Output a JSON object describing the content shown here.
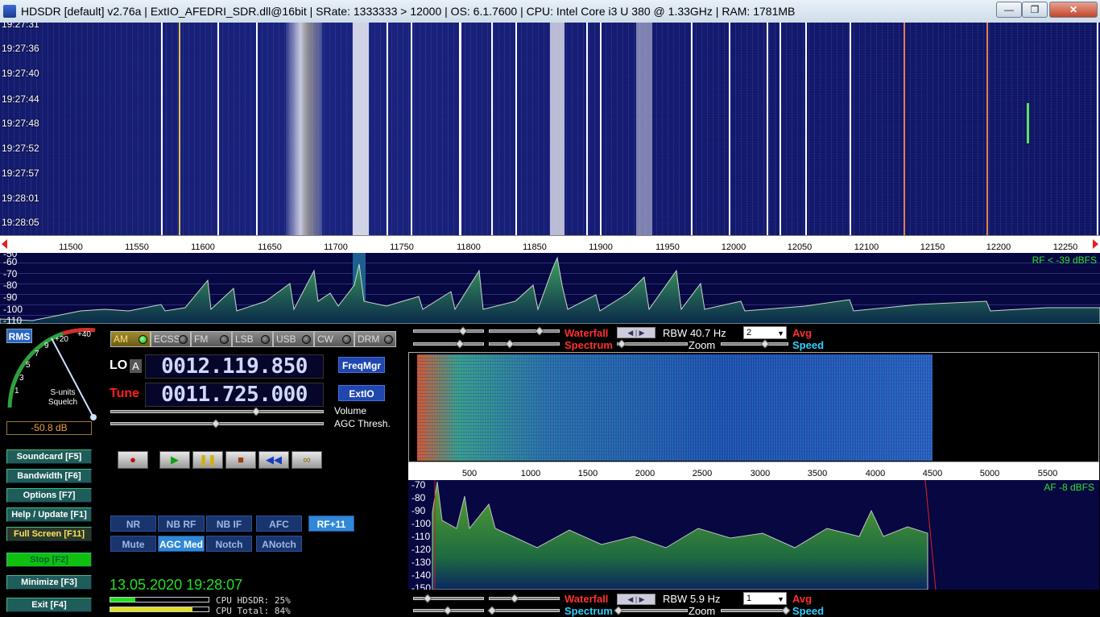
{
  "title_bar": {
    "text": "HDSDR  [default]  v2.76a  |  ExtIO_AFEDRI_SDR.dll@16bit  |  SRate: 1333333 > 12000  |  OS: 6.1.7600    |  CPU: Intel Core i3       U 380  @ 1.33GHz  |  RAM: 1781MB",
    "minimize": "—",
    "maximize": "❐",
    "close": "✕"
  },
  "waterfall_top": {
    "timestamps": [
      "19:27:31",
      "19:27:36",
      "19:27:40",
      "19:27:44",
      "19:27:48",
      "19:27:52",
      "19:27:57",
      "19:28:01",
      "19:28:05"
    ]
  },
  "freq_axis": {
    "ticks": [
      "11500",
      "11550",
      "11600",
      "11650",
      "11700",
      "11750",
      "11800",
      "11850",
      "11900",
      "11950",
      "12000",
      "12050",
      "12100",
      "12150",
      "12200",
      "12250"
    ]
  },
  "rf_spectrum": {
    "db_labels": [
      "-50",
      "-60",
      "-70",
      "-80",
      "-90",
      "-100",
      "-110"
    ],
    "rf_status": "RF < -39 dBFS"
  },
  "smeter": {
    "rms_label": "RMS",
    "scale": [
      "1",
      "3",
      "5",
      "7",
      "9",
      "+20",
      "+40"
    ],
    "s_units": "S-units",
    "squelch": "Squelch",
    "readout": "-50.8 dB"
  },
  "modes": [
    {
      "label": "AM",
      "active": true
    },
    {
      "label": "ECSS",
      "active": false
    },
    {
      "label": "FM",
      "active": false
    },
    {
      "label": "LSB",
      "active": false
    },
    {
      "label": "USB",
      "active": false
    },
    {
      "label": "CW",
      "active": false
    },
    {
      "label": "DRM",
      "active": false
    }
  ],
  "lo": {
    "label": "LO",
    "lock": "A",
    "freq": "0012.119.850"
  },
  "tune": {
    "label": "Tune",
    "freq": "0011.725.000"
  },
  "buttons_right_freq": {
    "freqmgr": "FreqMgr",
    "extio": "ExtIO"
  },
  "sliders": {
    "volume": "Volume",
    "agc": "AGC Thresh."
  },
  "transport": {
    "record": "●",
    "play": "▶",
    "pause": "❚❚",
    "stop": "■",
    "rewind": "◀◀",
    "loop": "∞"
  },
  "dsp_row1": [
    "NR",
    "NB RF",
    "NB IF",
    "AFC",
    "RF+11"
  ],
  "dsp_row2": [
    "Mute",
    "AGC Med",
    "Notch",
    "ANotch"
  ],
  "left_buttons": {
    "soundcard": "Soundcard   [F5]",
    "bandwidth": "Bandwidth   [F6]",
    "options": "Options   [F7]",
    "help": "Help / Update   [F1]",
    "fullscreen": "Full Screen   [F11]",
    "stop": "Stop        [F2]",
    "minimize": "Minimize   [F3]",
    "exit": "Exit         [F4]"
  },
  "status": {
    "datetime": "13.05.2020 19:28:07",
    "cpu_hdsdr": "CPU HDSDR: 25%",
    "cpu_total": "CPU Total: 84%",
    "cpu_hdsdr_fraction": 0.25,
    "cpu_total_fraction": 0.84
  },
  "rf_controls": {
    "waterfall": "Waterfall",
    "spectrum": "Spectrum",
    "rbw": "RBW  40.7 Hz",
    "avg_value": "2",
    "avg": "Avg",
    "zoom": "Zoom",
    "speed": "Speed"
  },
  "af_axis": {
    "ticks": [
      "500",
      "1000",
      "1500",
      "2000",
      "2500",
      "3000",
      "3500",
      "4000",
      "4500",
      "5000",
      "5500"
    ]
  },
  "af_spectrum": {
    "db_labels": [
      "-70",
      "-80",
      "-90",
      "-100",
      "-110",
      "-120",
      "-130",
      "-140",
      "-150"
    ],
    "af_status": "AF   -8 dBFS"
  },
  "af_controls": {
    "waterfall": "Waterfall",
    "spectrum": "Spectrum",
    "rbw": "RBW   5.9 Hz",
    "avg_value": "1",
    "avg": "Avg",
    "zoom": "Zoom",
    "speed": "Speed"
  },
  "colors": {
    "accent_green": "#20e020",
    "red": "#ff3030",
    "cyan": "#30d0ff"
  }
}
